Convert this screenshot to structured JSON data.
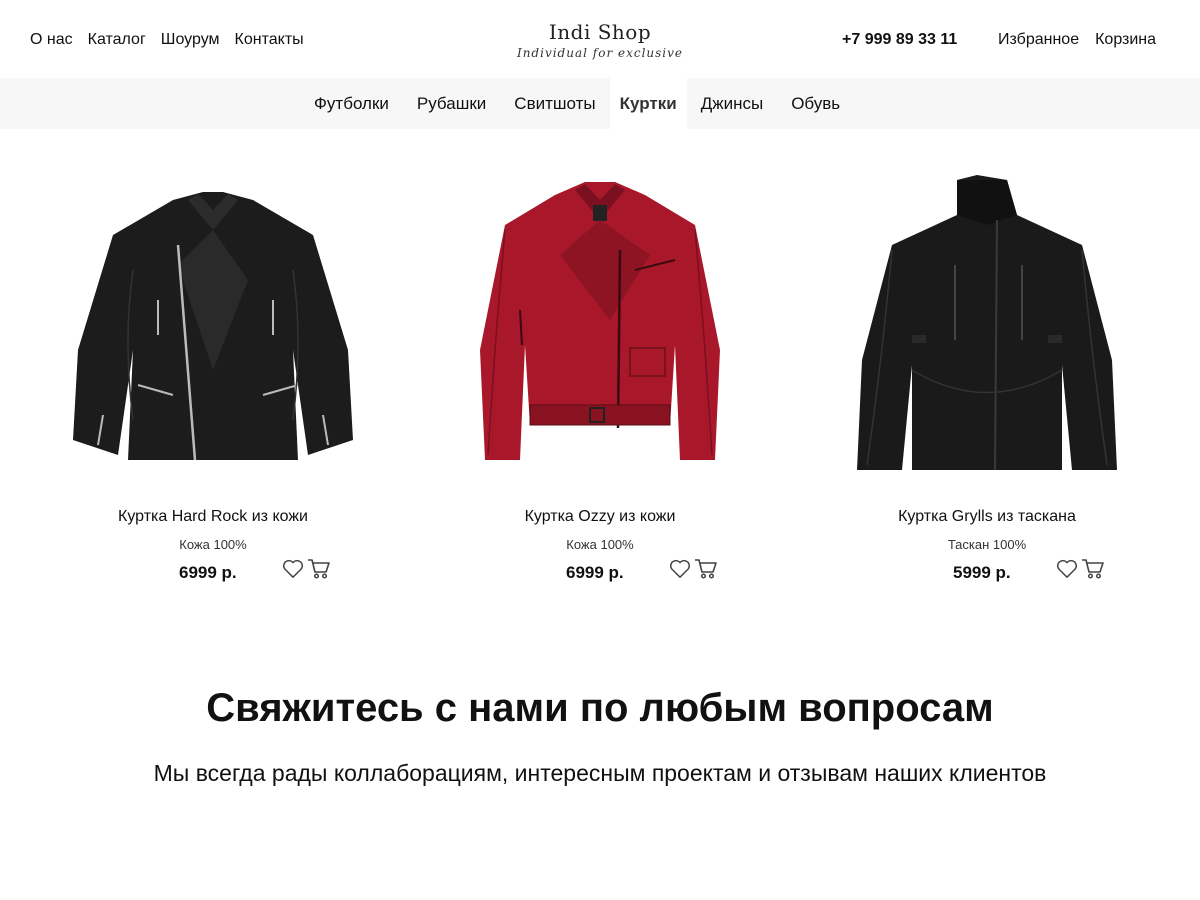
{
  "header": {
    "left_links": [
      "О нас",
      "Каталог",
      "Шоурум",
      "Контакты"
    ],
    "logo_title": "Indi Shop",
    "logo_subtitle": "Individual for exclusive",
    "phone": "+7 999 89 33 11",
    "right_links": [
      "Избранное",
      "Корзина"
    ]
  },
  "categories": {
    "items": [
      "Футболки",
      "Рубашки",
      "Свитшоты",
      "Куртки",
      "Джинсы",
      "Обувь"
    ],
    "active": "Куртки"
  },
  "products": [
    {
      "name": "Куртка Hard Rock из кожи",
      "material": "Кожа 100%",
      "price": "6999 р.",
      "image": "black-leather-jacket"
    },
    {
      "name": "Куртка Ozzy из кожи",
      "material": "Кожа 100%",
      "price": "6999 р.",
      "image": "red-leather-jacket"
    },
    {
      "name": "Куртка Grylls из таскана",
      "material": "Таскан 100%",
      "price": "5999 р.",
      "image": "black-outdoor-jacket"
    }
  ],
  "contact": {
    "title": "Свяжитесь с нами по любым вопросам",
    "subtitle": "Мы всегда рады коллаборациям, интересным проектам и отзывам наших клиентов"
  },
  "icons": {
    "favorite": "heart-icon",
    "cart": "cart-icon"
  },
  "colors": {
    "category_bar": "#f7f7f7",
    "text": "#111111",
    "red_jacket": "#a8182a",
    "black_jacket": "#1a1a1a"
  }
}
